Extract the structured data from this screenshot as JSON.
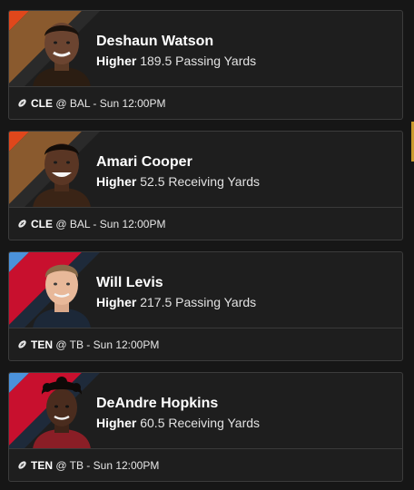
{
  "picks": [
    {
      "player": "Deshaun Watson",
      "direction": "Higher",
      "line": "189.5",
      "stat": "Passing Yards",
      "team": "CLE",
      "matchup": "@ BAL - Sun 12:00PM",
      "stripe_colors": [
        "#e0471b",
        "#8a5a2e",
        "#2a2a2a"
      ],
      "jersey_color": "#2b1d12"
    },
    {
      "player": "Amari Cooper",
      "direction": "Higher",
      "line": "52.5",
      "stat": "Receiving Yards",
      "team": "CLE",
      "matchup": "@ BAL - Sun 12:00PM",
      "stripe_colors": [
        "#e0471b",
        "#8a5a2e",
        "#2a2a2a"
      ],
      "jersey_color": "#3a2416"
    },
    {
      "player": "Will Levis",
      "direction": "Higher",
      "line": "217.5",
      "stat": "Passing Yards",
      "team": "TEN",
      "matchup": "@ TB - Sun 12:00PM",
      "stripe_colors": [
        "#4b92db",
        "#c8102e",
        "#1e2a3a"
      ],
      "jersey_color": "#1c2838"
    },
    {
      "player": "DeAndre Hopkins",
      "direction": "Higher",
      "line": "60.5",
      "stat": "Receiving Yards",
      "team": "TEN",
      "matchup": "@ TB - Sun 12:00PM",
      "stripe_colors": [
        "#4b92db",
        "#c8102e",
        "#1e2a3a"
      ],
      "jersey_color": "#8a1e26"
    }
  ]
}
